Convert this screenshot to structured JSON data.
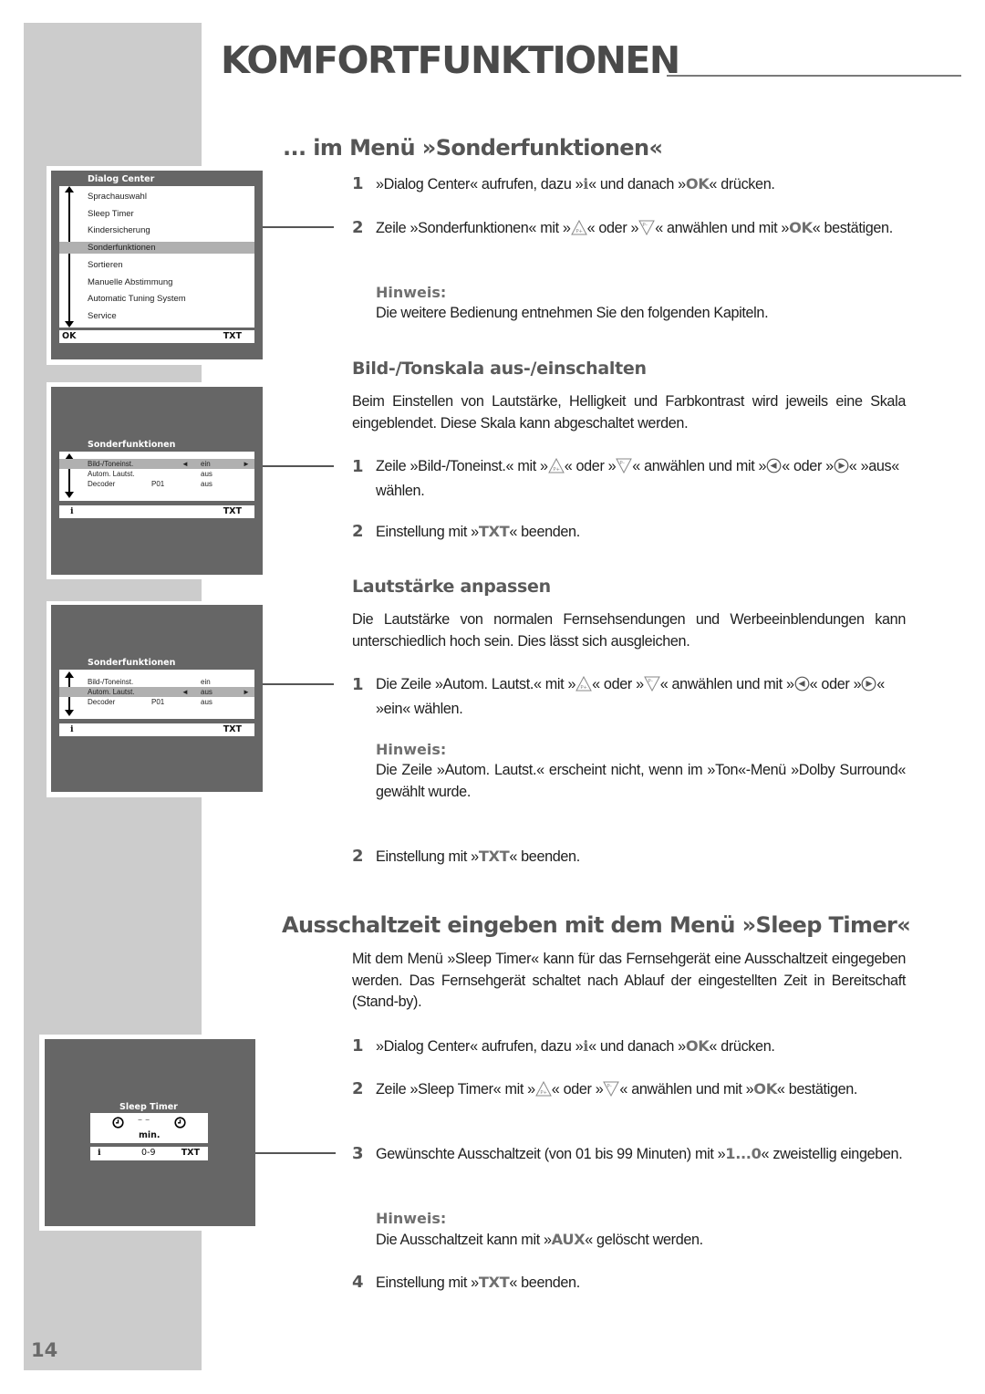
{
  "page": {
    "title": "KOMFORTFUNKTIONEN",
    "page_number": "14"
  },
  "section_sonder": {
    "heading": "... im Menü »Sonderfunktionen«",
    "step1": {
      "num": "1",
      "pre": "»Dialog Center« aufrufen, dazu »",
      "key_i": "i",
      "mid": "« und danach »",
      "key_ok": "OK",
      "post": "« drücken."
    },
    "step2": {
      "num": "2",
      "pre": "Zeile »Sonderfunktionen« mit »",
      "mid1": "« oder »",
      "mid2": "« anwählen und mit »",
      "key_ok": "OK",
      "post": "« bestätigen."
    },
    "note_label": "Hinweis:",
    "note_text": "Die weitere Bedienung entnehmen Sie den folgenden Kapiteln."
  },
  "section_bildton": {
    "heading": "Bild-/Tonskala aus-/einschalten",
    "intro": "Beim Einstellen von Lautstärke, Helligkeit und Farbkontrast wird jeweils eine Skala eingeblendet. Diese Skala kann abgeschaltet werden.",
    "step1": {
      "num": "1",
      "pre": "Zeile »Bild-/Toneinst.« mit »",
      "mid1": "« oder »",
      "mid2": "« anwählen und mit »",
      "mid3": "« oder »",
      "post": "« »aus« wählen."
    },
    "step2": {
      "num": "2",
      "pre": "Einstellung mit »",
      "key": "TXT",
      "post": "« beenden."
    }
  },
  "section_lautstaerke": {
    "heading": "Lautstärke anpassen",
    "intro": "Die Lautstärke von normalen Fernsehsendungen und Werbeeinblendungen kann unterschiedlich hoch sein. Dies lässt sich ausgleichen.",
    "step1": {
      "num": "1",
      "pre": "Die Zeile »Autom. Lautst.« mit »",
      "mid1": "« oder »",
      "mid2": "« anwählen und mit »",
      "mid3": "« oder »",
      "post": "« »ein« wählen."
    },
    "note_label": "Hinweis:",
    "note_text": "Die Zeile »Autom. Lautst.« erscheint nicht, wenn im »Ton«-Menü »Dolby Surround« gewählt wurde.",
    "step2": {
      "num": "2",
      "pre": "Einstellung mit »",
      "key": "TXT",
      "post": "« beenden."
    }
  },
  "section_sleep": {
    "heading": "Ausschaltzeit eingeben mit dem Menü »Sleep Timer«",
    "intro": "Mit dem Menü »Sleep Timer« kann für das Fernsehgerät eine Ausschaltzeit eingegeben werden. Das Fernsehgerät schaltet nach Ablauf der eingestellten Zeit in Bereitschaft (Stand-by).",
    "step1": {
      "num": "1",
      "pre": "»Dialog Center« aufrufen, dazu »",
      "key_i": "i",
      "mid": "« und danach »",
      "key_ok": "OK",
      "post": "« drücken."
    },
    "step2": {
      "num": "2",
      "pre": "Zeile »Sleep Timer« mit »",
      "mid1": "« oder »",
      "mid2": "« anwählen und mit »",
      "key_ok": "OK",
      "post": "« bestätigen."
    },
    "step3": {
      "num": "3",
      "pre": "Gewünschte Ausschaltzeit (von 01 bis 99 Minuten) mit »",
      "key": "1...0",
      "post": "« zweistellig eingeben."
    },
    "note_label": "Hinweis:",
    "note_pre": "Die Ausschaltzeit kann mit »",
    "note_key": "AUX",
    "note_post": "« gelöscht werden.",
    "step4": {
      "num": "4",
      "pre": "Einstellung mit »",
      "key": "TXT",
      "post": "« beenden."
    }
  },
  "screens": {
    "dialog_center": {
      "title": "Dialog Center",
      "items": [
        "Sprachauswahl",
        "Sleep Timer",
        "Kindersicherung",
        "Sonderfunktionen",
        "Sortieren",
        "Manuelle Abstimmung",
        "Automatic Tuning System",
        "Service"
      ],
      "selected_index": 3,
      "footer_left": "OK",
      "footer_right": "TXT"
    },
    "sonder_1": {
      "title": "Sonderfunktionen",
      "rows": [
        {
          "label": "Bild-/Toneinst.",
          "extra": "",
          "value": "ein"
        },
        {
          "label": "Autom. Lautst.",
          "extra": "",
          "value": "aus"
        },
        {
          "label": "Decoder",
          "extra": "P01",
          "value": "aus"
        }
      ],
      "selected_index": 0,
      "left_arrow": "◄",
      "right_arrow": "►",
      "footer_left": "i",
      "footer_right": "TXT"
    },
    "sonder_2": {
      "title": "Sonderfunktionen",
      "rows": [
        {
          "label": "Bild-/Toneinst.",
          "extra": "",
          "value": "ein"
        },
        {
          "label": "Autom. Lautst.",
          "extra": "",
          "value": "aus"
        },
        {
          "label": "Decoder",
          "extra": "P01",
          "value": "aus"
        }
      ],
      "selected_index": 1,
      "left_arrow": "◄",
      "right_arrow": "►",
      "footer_left": "i",
      "footer_right": "TXT"
    },
    "sleep_timer": {
      "title": "Sleep Timer",
      "value": "– –",
      "unit": "min.",
      "footer_left": "i",
      "footer_mid": "0-9",
      "footer_right": "TXT"
    }
  },
  "icons": {
    "p_plus": "P+",
    "p_minus": "P–"
  }
}
